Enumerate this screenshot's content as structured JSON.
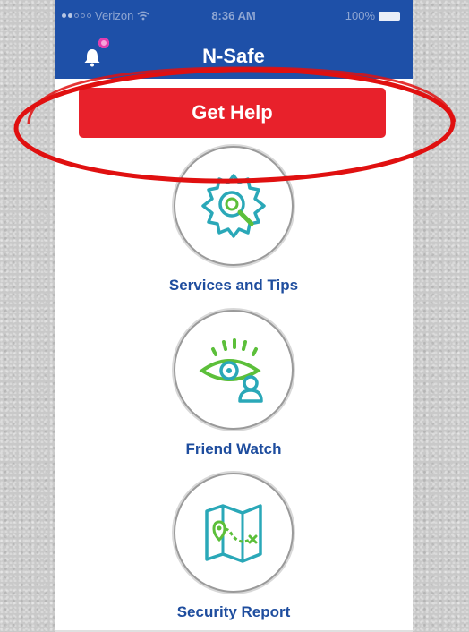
{
  "status_bar": {
    "carrier": "Verizon",
    "time": "8:36 AM",
    "battery": "100%",
    "signal_icon": "signal-dots-icon",
    "wifi_icon": "wifi-icon",
    "battery_icon": "battery-icon"
  },
  "header": {
    "title": "N-Safe",
    "notification_icon": "bell-icon",
    "background_color": "#1e50a8"
  },
  "get_help": {
    "label": "Get Help",
    "color": "#e8212b"
  },
  "menu": [
    {
      "label": "Services and Tips",
      "icon": "gear-magnifier-icon"
    },
    {
      "label": "Friend Watch",
      "icon": "eye-person-icon"
    },
    {
      "label": "Security Report",
      "icon": "map-route-icon"
    }
  ],
  "colors": {
    "label_color": "#1e4d9e",
    "icon_teal": "#2aa8b8",
    "icon_green": "#5cbf3a",
    "annotation_red": "#e01010"
  }
}
